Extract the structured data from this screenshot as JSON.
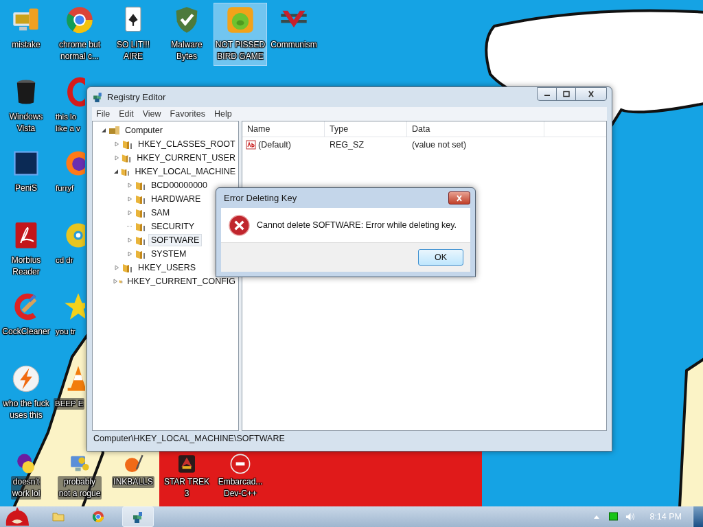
{
  "desktop_icons": [
    {
      "lines": [
        "mistake"
      ],
      "selected": false
    },
    {
      "lines": [
        "chrome but",
        "normal c..."
      ],
      "selected": false
    },
    {
      "lines": [
        "SO LIT!!!",
        "AIRE"
      ],
      "selected": false
    },
    {
      "lines": [
        "Malware",
        "Bytes"
      ],
      "selected": false
    },
    {
      "lines": [
        "NOT PISSED",
        "BIRD GAME"
      ],
      "selected": true
    },
    {
      "lines": [
        "Communism"
      ],
      "selected": false
    },
    {
      "lines": [
        "Windows",
        "Vista"
      ],
      "selected": false
    },
    {
      "lines": [
        "this lo",
        "like a v"
      ],
      "selected": false
    },
    {
      "lines": [
        "PeniS"
      ],
      "selected": false
    },
    {
      "lines": [
        "furryf"
      ],
      "selected": false
    },
    {
      "lines": [
        "Morbius",
        "Reader"
      ],
      "selected": false
    },
    {
      "lines": [
        "cd dr"
      ],
      "selected": false
    },
    {
      "lines": [
        "CockCleaner"
      ],
      "selected": false
    },
    {
      "lines": [
        "you tr"
      ],
      "selected": false
    },
    {
      "lines": [
        "who the fuck",
        "uses this"
      ],
      "selected": false
    },
    {
      "lines": [
        "BEEP E"
      ],
      "selected": false
    },
    {
      "lines": [
        "doesn't",
        "work lol"
      ],
      "selected": false
    },
    {
      "lines": [
        "probably",
        "not a rogue"
      ],
      "selected": false
    },
    {
      "lines": [
        "INKBALLS"
      ],
      "selected": false
    },
    {
      "lines": [
        "STAR TREK",
        "3"
      ],
      "selected": false
    },
    {
      "lines": [
        "Embarcad...",
        "Dev-C++"
      ],
      "selected": false
    }
  ],
  "registry": {
    "title": "Registry Editor",
    "menu": [
      "File",
      "Edit",
      "View",
      "Favorites",
      "Help"
    ],
    "tree": [
      {
        "label": "Computer",
        "expandable": true,
        "expanded": true,
        "selected": false,
        "children": [
          {
            "label": "HKEY_CLASSES_ROOT",
            "expandable": true,
            "expanded": false,
            "selected": false
          },
          {
            "label": "HKEY_CURRENT_USER",
            "expandable": true,
            "expanded": false,
            "selected": false
          },
          {
            "label": "HKEY_LOCAL_MACHINE",
            "expandable": true,
            "expanded": true,
            "selected": false,
            "children": [
              {
                "label": "BCD00000000",
                "expandable": true,
                "expanded": false,
                "selected": false
              },
              {
                "label": "HARDWARE",
                "expandable": true,
                "expanded": false,
                "selected": false
              },
              {
                "label": "SAM",
                "expandable": true,
                "expanded": false,
                "selected": false
              },
              {
                "label": "SECURITY",
                "expandable": false,
                "expanded": false,
                "selected": false
              },
              {
                "label": "SOFTWARE",
                "expandable": true,
                "expanded": false,
                "selected": true
              },
              {
                "label": "SYSTEM",
                "expandable": true,
                "expanded": false,
                "selected": false
              }
            ]
          },
          {
            "label": "HKEY_USERS",
            "expandable": true,
            "expanded": false,
            "selected": false
          },
          {
            "label": "HKEY_CURRENT_CONFIG",
            "expandable": true,
            "expanded": false,
            "selected": false
          }
        ]
      }
    ],
    "columns": [
      "Name",
      "Type",
      "Data"
    ],
    "rows": [
      {
        "name": "(Default)",
        "type": "REG_SZ",
        "data": "(value not set)"
      }
    ],
    "status_bar": "Computer\\HKEY_LOCAL_MACHINE\\SOFTWARE"
  },
  "dialog": {
    "title": "Error Deleting Key",
    "message": "Cannot delete SOFTWARE:  Error while deleting key.",
    "button": "OK"
  },
  "taskbar": {
    "items": [
      {
        "selected": false
      },
      {
        "selected": false
      },
      {
        "selected": true
      }
    ],
    "clock": "8:14 PM"
  }
}
